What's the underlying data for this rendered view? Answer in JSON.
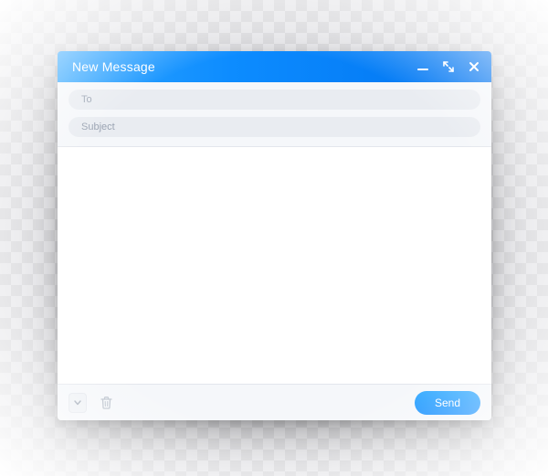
{
  "window": {
    "title": "New Message"
  },
  "fields": {
    "to_placeholder": "To",
    "to_value": "",
    "subject_placeholder": "Subject",
    "subject_value": ""
  },
  "body": {
    "value": ""
  },
  "footer": {
    "send_label": "Send"
  },
  "icons": {
    "minimize": "minimize-icon",
    "expand": "expand-icon",
    "close": "close-icon",
    "more": "chevron-down-icon",
    "trash": "trash-icon"
  },
  "colors": {
    "accent_start": "#30a6ff",
    "accent_end": "#0073f0",
    "field_bg": "#e9ecf1",
    "panel_bg": "#f5f7fa"
  }
}
